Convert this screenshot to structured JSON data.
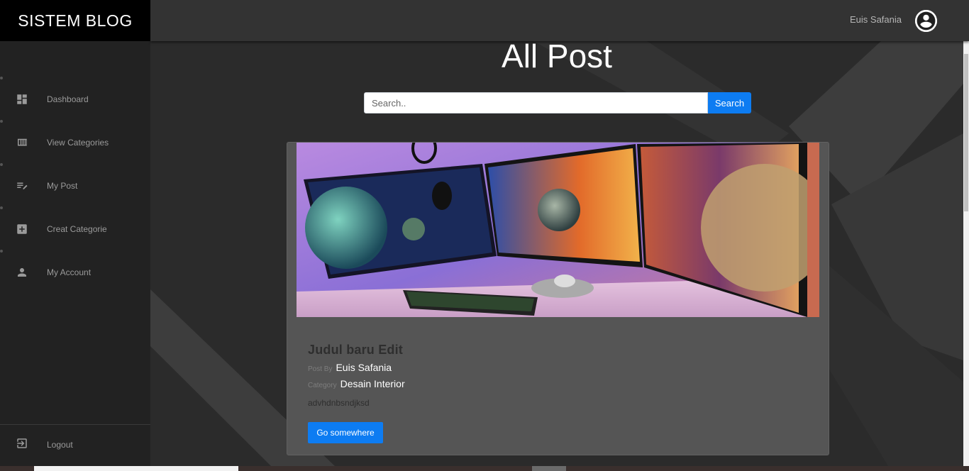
{
  "brand": {
    "title": "SISTEM BLOG"
  },
  "sidebar": {
    "items": [
      {
        "label": "Dashboard",
        "icon": "dashboard-icon"
      },
      {
        "label": "View Categories",
        "icon": "view-columns-icon"
      },
      {
        "label": "My Post",
        "icon": "playlist-edit-icon"
      },
      {
        "label": "Creat Categorie",
        "icon": "add-box-icon"
      },
      {
        "label": "My Account",
        "icon": "person-icon"
      }
    ],
    "logout": {
      "label": "Logout",
      "icon": "logout-icon"
    }
  },
  "topbar": {
    "username": "Euis Safania",
    "avatar_icon": "account-circle-icon"
  },
  "main": {
    "title": "All Post",
    "search": {
      "placeholder": "Search..",
      "button_label": "Search"
    },
    "post": {
      "image_alt": "Triple monitor desk setup with space wallpapers",
      "title": "Judul baru Edit",
      "post_by_label": "Post By",
      "author": "Euis Safania",
      "category_label": "Category",
      "category": "Desain Interior",
      "excerpt": "advhdnbsndjksd",
      "button_label": "Go somewhere"
    }
  },
  "colors": {
    "accent": "#0d7cf2",
    "sidebar_bg": "#222222",
    "topbar_bg": "#333333",
    "card_bg": "#555555"
  }
}
